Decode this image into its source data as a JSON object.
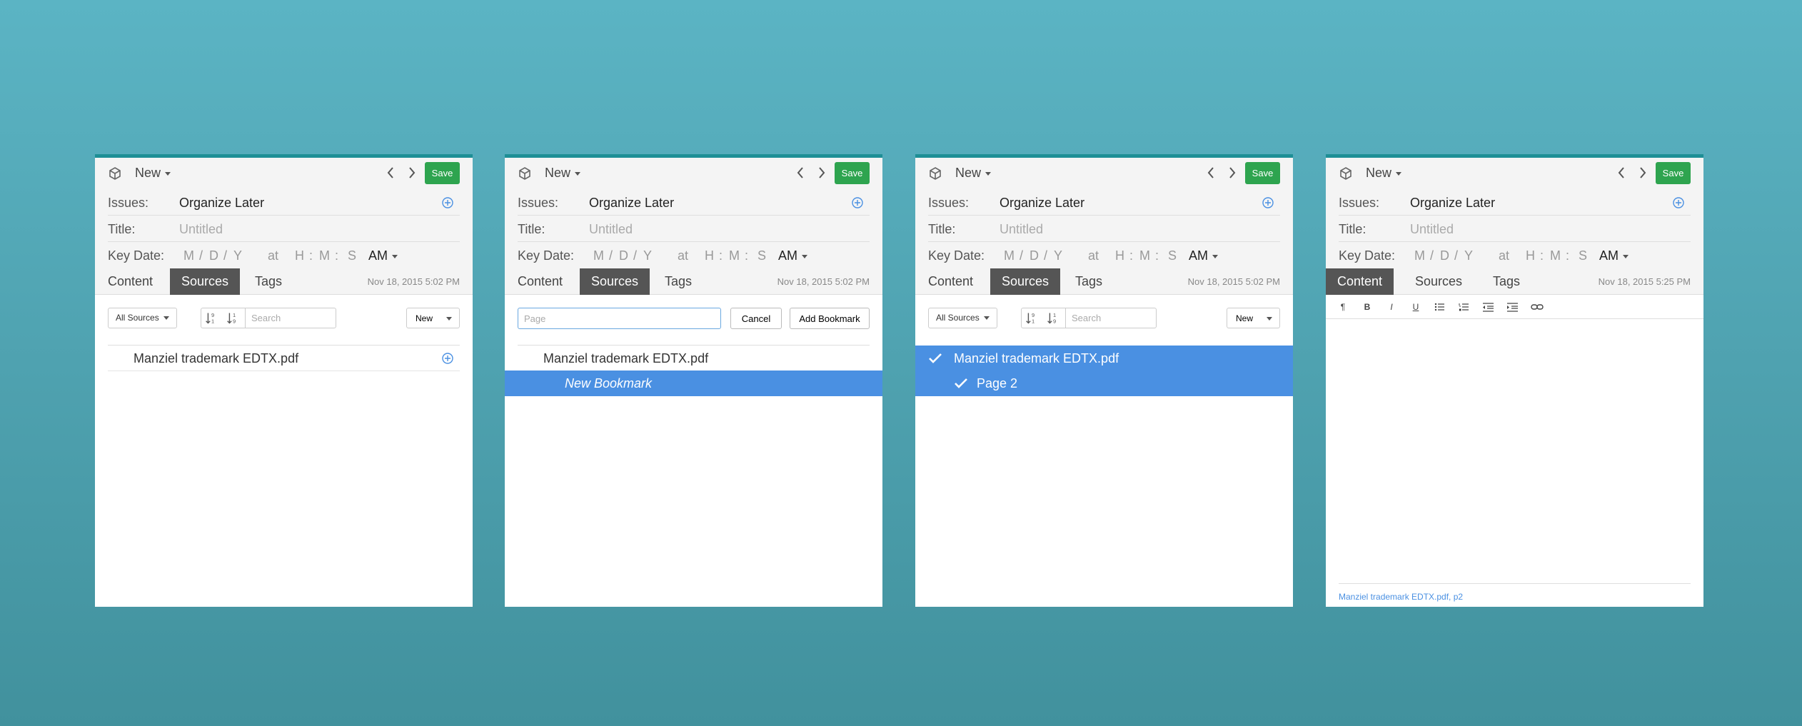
{
  "colors": {
    "accent": "#1e8f96",
    "save": "#2ea44f",
    "selection": "#4a90e2",
    "active_tab": "#555555"
  },
  "common": {
    "new_label": "New",
    "save_label": "Save",
    "issues_label": "Issues:",
    "issues_value": "Organize Later",
    "title_label": "Title:",
    "title_placeholder": "Untitled",
    "keydate_label": "Key Date:",
    "date_m": "M",
    "date_sep1": "/",
    "date_d": "D",
    "date_sep2": "/",
    "date_y": "Y",
    "at": "at",
    "time_h": "H",
    "time_sep1": ":",
    "time_m": "M",
    "time_sep2": ":",
    "time_s": "S",
    "ampm": "AM",
    "tabs": {
      "content": "Content",
      "sources": "Sources",
      "tags": "Tags"
    },
    "icons": {
      "app": "box-icon",
      "prev": "chevron-left-icon",
      "next": "chevron-right-icon",
      "add": "plus-circle-icon"
    }
  },
  "panels": [
    {
      "date": "Nov 18, 2015 5:02 PM",
      "all_sources": "All Sources",
      "search_placeholder": "Search",
      "new_btn": "New",
      "items": [
        {
          "label": "Manziel trademark EDTX.pdf"
        }
      ]
    },
    {
      "date": "Nov 18, 2015 5:02 PM",
      "page_placeholder": "Page",
      "cancel": "Cancel",
      "add_bookmark": "Add Bookmark",
      "items": [
        {
          "label": "Manziel trademark EDTX.pdf"
        },
        {
          "label": "New Bookmark"
        }
      ]
    },
    {
      "date": "Nov 18, 2015 5:02 PM",
      "all_sources": "All Sources",
      "search_placeholder": "Search",
      "new_btn": "New",
      "items": [
        {
          "label": "Manziel trademark EDTX.pdf"
        },
        {
          "label": "Page 2"
        }
      ]
    },
    {
      "date": "Nov 18, 2015 5:25 PM",
      "editor_tools": {
        "paragraph": "¶",
        "bold": "B",
        "italic": "I",
        "underline": "U"
      },
      "footer_link": "Manziel trademark EDTX.pdf, p2"
    }
  ]
}
